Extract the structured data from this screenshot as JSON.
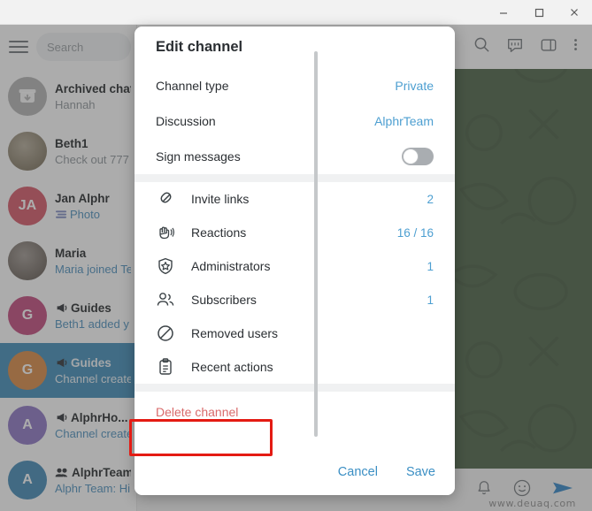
{
  "window": {
    "minimize_icon": "minimize-icon",
    "maximize_icon": "maximize-icon",
    "close_icon": "close-icon"
  },
  "sidebar": {
    "menu_icon": "hamburger-menu-icon",
    "search_placeholder": "Search",
    "chats": [
      {
        "name": "Archived chat",
        "preview": "Hannah",
        "avatar_label": "",
        "avatar_color": "#b3b3b3",
        "avatar_icon": "archive-box-icon",
        "type": "archive",
        "preview_blue": false,
        "selected": false
      },
      {
        "name": "Beth1",
        "preview": "Check out 777",
        "avatar_label": "",
        "avatar_color": "#8d7f63",
        "avatar_icon": "photo-avatar",
        "type": "user",
        "preview_blue": false,
        "selected": false
      },
      {
        "name": "Jan Alphr",
        "preview": "Photo",
        "avatar_label": "JA",
        "avatar_color": "#d65565",
        "avatar_icon": "",
        "type": "user",
        "preview_blue": true,
        "preview_icon": "photo-thumb-icon",
        "selected": false
      },
      {
        "name": "Maria",
        "preview": "Maria joined Te",
        "avatar_label": "",
        "avatar_color": "#6e6258",
        "avatar_icon": "photo-avatar",
        "type": "user",
        "preview_blue": true,
        "selected": false
      },
      {
        "name": "Guides",
        "preview": "Beth1 added y",
        "avatar_label": "G",
        "avatar_color": "#c2457a",
        "avatar_icon": "",
        "type": "channel",
        "preview_blue": true,
        "selected": false
      },
      {
        "name": "Guides",
        "preview": "Channel create",
        "avatar_label": "G",
        "avatar_color": "#d98841",
        "avatar_icon": "",
        "type": "channel",
        "preview_blue": false,
        "selected": true
      },
      {
        "name": "AlphrHo...",
        "preview": "Channel create",
        "avatar_label": "A",
        "avatar_color": "#8b74c4",
        "avatar_icon": "",
        "type": "channel",
        "preview_blue": true,
        "selected": false
      },
      {
        "name": "AlphrTeam",
        "preview": "Alphr Team: Hi",
        "avatar_label": "A",
        "avatar_color": "#3f87b5",
        "avatar_icon": "",
        "type": "group",
        "preview_blue": true,
        "selected": false
      }
    ]
  },
  "chat_header": {
    "icons": [
      "search-icon",
      "discussion-icon",
      "panel-icon",
      "more-options-icon"
    ]
  },
  "composer": {
    "icons": [
      "bell-icon",
      "emoji-icon",
      "send-icon"
    ],
    "watermark": "www.deuaq.com"
  },
  "dialog": {
    "title": "Edit channel",
    "settings": [
      {
        "label": "Channel type",
        "value": "Private",
        "kind": "link"
      },
      {
        "label": "Discussion",
        "value": "AlphrTeam",
        "kind": "link"
      },
      {
        "label": "Sign messages",
        "value": "",
        "kind": "toggle",
        "toggle_on": false
      }
    ],
    "items": [
      {
        "icon": "invite-link-icon",
        "label": "Invite links",
        "count": "2"
      },
      {
        "icon": "reactions-hand-icon",
        "label": "Reactions",
        "count": "16 / 16"
      },
      {
        "icon": "administrators-shield-icon",
        "label": "Administrators",
        "count": "1"
      },
      {
        "icon": "subscribers-people-icon",
        "label": "Subscribers",
        "count": "1"
      },
      {
        "icon": "removed-users-block-icon",
        "label": "Removed users",
        "count": ""
      },
      {
        "icon": "recent-actions-clipboard-icon",
        "label": "Recent actions",
        "count": ""
      }
    ],
    "delete_label": "Delete channel",
    "cancel_label": "Cancel",
    "save_label": "Save"
  },
  "colors": {
    "link": "#4d9fd1",
    "danger": "#d96a6a",
    "annotation": "#e41b13",
    "selected_row": "#3c8ab8",
    "wallpaper": "#485f43"
  }
}
